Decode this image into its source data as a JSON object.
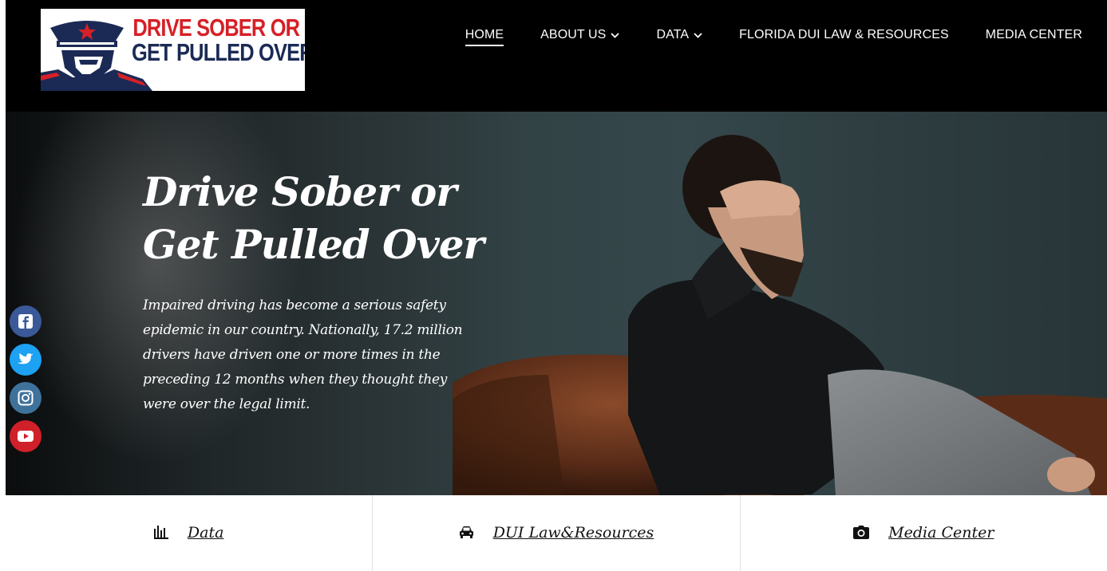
{
  "logo": {
    "line1": "DRIVE SOBER OR",
    "line2": "GET PULLED OVER",
    "icon": "police-officer-icon"
  },
  "nav": {
    "items": [
      {
        "label": "HOME",
        "active": true
      },
      {
        "label": "ABOUT US",
        "dropdown": true
      },
      {
        "label": "DATA",
        "dropdown": true
      },
      {
        "label": "FLORIDA DUI LAW & RESOURCES"
      },
      {
        "label": "MEDIA CENTER"
      }
    ]
  },
  "hero": {
    "title_line1": "Drive Sober or",
    "title_line2": "Get Pulled Over",
    "text": "Impaired driving has become a serious safety epidemic in our country. Nationally, 17.2 million drivers have driven one or more times in the preceding 12 months when they thought they were over the legal limit."
  },
  "social": [
    {
      "icon": "facebook-icon",
      "color": "#3b5998"
    },
    {
      "icon": "twitter-icon",
      "color": "#1da1f2"
    },
    {
      "icon": "instagram-icon",
      "color": "#3f729b"
    },
    {
      "icon": "youtube-icon",
      "color": "#d0202a"
    }
  ],
  "quicklinks": [
    {
      "label": "Data",
      "icon": "bar-chart-icon"
    },
    {
      "label": "DUI Law&Resources",
      "icon": "car-icon"
    },
    {
      "label": "Media Center",
      "icon": "camera-icon"
    }
  ],
  "colors": {
    "brand_red": "#d62027",
    "brand_navy": "#1b2a55",
    "header_bg": "#000000"
  }
}
